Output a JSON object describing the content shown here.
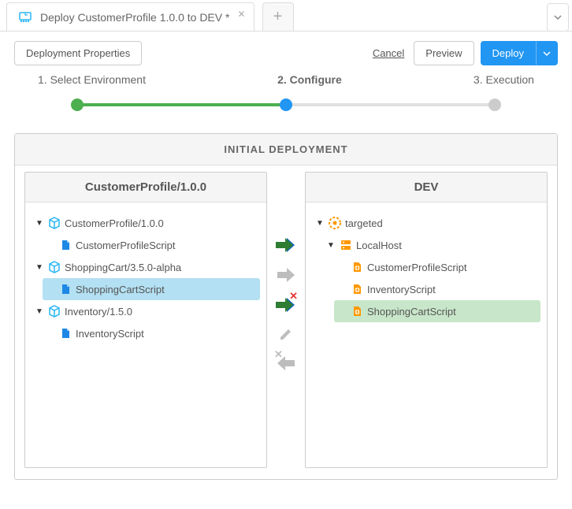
{
  "tab": {
    "title": "Deploy CustomerProfile 1.0.0 to DEV *"
  },
  "toolbar": {
    "properties": "Deployment Properties",
    "cancel": "Cancel",
    "preview": "Preview",
    "deploy": "Deploy"
  },
  "stepper": {
    "step1": "1. Select Environment",
    "step2": "2. Configure",
    "step3": "3. Execution",
    "active": 2
  },
  "panel": {
    "title": "INITIAL DEPLOYMENT",
    "leftHeader": "CustomerProfile/1.0.0",
    "rightHeader": "DEV"
  },
  "leftTree": {
    "pkg1": "CustomerProfile/1.0.0",
    "pkg1_item1": "CustomerProfileScript",
    "pkg2": "ShoppingCart/3.5.0-alpha",
    "pkg2_item1": "ShoppingCartScript",
    "pkg3": "Inventory/1.5.0",
    "pkg3_item1": "InventoryScript"
  },
  "rightTree": {
    "root": "targeted",
    "host": "LocalHost",
    "item1": "CustomerProfileScript",
    "item2": "InventoryScript",
    "item3": "ShoppingCartScript"
  }
}
